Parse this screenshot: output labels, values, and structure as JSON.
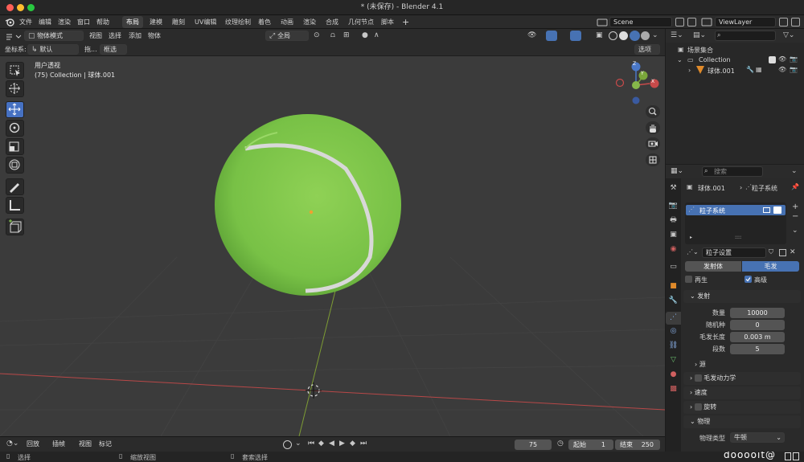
{
  "window": {
    "title": "* (未保存) - Blender 4.1"
  },
  "topbar": {
    "menus": [
      "文件",
      "编辑",
      "渲染",
      "窗口",
      "帮助"
    ],
    "workspaces": [
      "布局",
      "建模",
      "雕刻",
      "UV编辑",
      "纹理绘制",
      "着色",
      "动画",
      "渲染",
      "合成",
      "几何节点",
      "脚本"
    ],
    "active_workspace": "布局",
    "scene": "Scene",
    "view_layer": "ViewLayer"
  },
  "viewport_header": {
    "mode": "物体模式",
    "menus": [
      "视图",
      "选择",
      "添加",
      "物体"
    ],
    "transform_orientation": "全局",
    "coord_label": "坐标系:",
    "coord_value": "默认",
    "drag_label": "拖...",
    "select_mode": "框选",
    "options": "选项"
  },
  "viewport": {
    "view_name": "用户透视",
    "object_info": "(75) Collection | 球体.001",
    "gizmo_axes": [
      "X",
      "Y",
      "Z"
    ]
  },
  "timeline": {
    "menus": [
      "回放",
      "插帧",
      "视图",
      "标记"
    ],
    "current_frame": "75",
    "start_label": "起始",
    "start": "1",
    "end_label": "结束",
    "end": "250"
  },
  "statusbar": {
    "items": [
      "选择",
      "缩放视图",
      "套索选择"
    ],
    "watermark": "dooooit@"
  },
  "outliner": {
    "search_placeholder": "",
    "root": "场景集合",
    "collection": "Collection",
    "object": "球体.001"
  },
  "properties": {
    "search_placeholder": "搜索",
    "breadcrumb_object": "球体.001",
    "breadcrumb_item": "粒子系统",
    "particle_system": "粒子系统",
    "settings_name": "粒子设置",
    "type_emitter": "发射体",
    "type_hair": "毛发",
    "active_type": "毛发",
    "regrow_label": "再生",
    "regrow": false,
    "advanced_label": "高级",
    "advanced": true,
    "emission_section": "发射",
    "fields": [
      {
        "label": "数量",
        "value": "10000"
      },
      {
        "label": "随机种",
        "value": "0"
      },
      {
        "label": "毛发长度",
        "value": "0.003 m"
      },
      {
        "label": "段数",
        "value": "5"
      }
    ],
    "source_section": "源",
    "hair_dynamics_section": "毛发动力学",
    "velocity_section": "速度",
    "rotation_section": "旋转",
    "physics_section": "物理",
    "physics_type_label": "物理类型",
    "physics_type_value": "牛顿"
  },
  "colors": {
    "accent": "#4772b3",
    "ball_green": "#7cc448",
    "axis_red": "#c04a4a",
    "axis_green": "#6f9a2a"
  }
}
